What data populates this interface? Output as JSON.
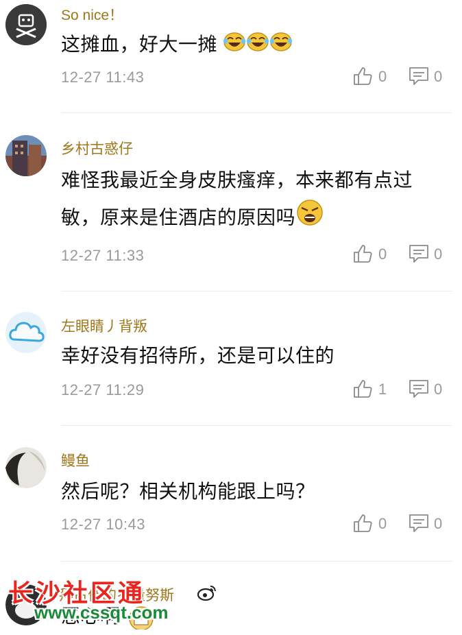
{
  "comments": [
    {
      "user": "So nice！",
      "text": "这摊血，好大一摊",
      "time": "12-27 11:43",
      "likes": "0",
      "replies": "0",
      "emojis": [
        "laughing-tears-emoji",
        "laughing-tears-emoji",
        "laughing-tears-emoji"
      ]
    },
    {
      "user": "乡村古惑仔",
      "line1": "难怪我最近全身皮肤瘙痒，本来都有点过",
      "line2": "敏，原来是住酒店的原因吗",
      "time": "12-27 11:33",
      "likes": "0",
      "replies": "0",
      "emojis": [
        "angry-emoji"
      ]
    },
    {
      "user": "左眼睛丿背叛",
      "text": "幸好没有招待所，还是可以住的",
      "time": "12-27 11:29",
      "likes": "1",
      "replies": "0"
    },
    {
      "user": "鳗鱼",
      "text": "然后呢？相关机构能跟上吗？",
      "time": "12-27 10:43",
      "likes": "0",
      "replies": "0"
    },
    {
      "user": "拜古佳的罗量努斯",
      "text": "恶心啊"
    }
  ],
  "watermark": {
    "main": "长沙社区通",
    "url": "www.cssqt.com"
  },
  "colors": {
    "username": "#a0761a",
    "meta": "#9a9a9a",
    "watermark_red": "#e8261f",
    "watermark_green": "#1a8a3a"
  }
}
